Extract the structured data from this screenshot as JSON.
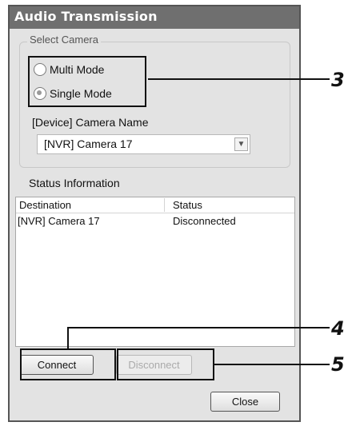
{
  "window": {
    "title": "Audio Transmission"
  },
  "select_camera": {
    "group_label": "Select Camera",
    "modes": [
      {
        "label": "Multi Mode",
        "checked": false
      },
      {
        "label": "Single Mode",
        "checked": true
      }
    ],
    "device_label": "[Device] Camera Name",
    "selected_camera": "[NVR] Camera 17"
  },
  "status": {
    "label": "Status Information",
    "columns": [
      "Destination",
      "Status"
    ],
    "rows": [
      {
        "destination": "[NVR] Camera 17",
        "status": "Disconnected"
      }
    ]
  },
  "buttons": {
    "connect": "Connect",
    "disconnect": "Disconnect",
    "close": "Close"
  },
  "callouts": [
    "3",
    "4",
    "5"
  ]
}
